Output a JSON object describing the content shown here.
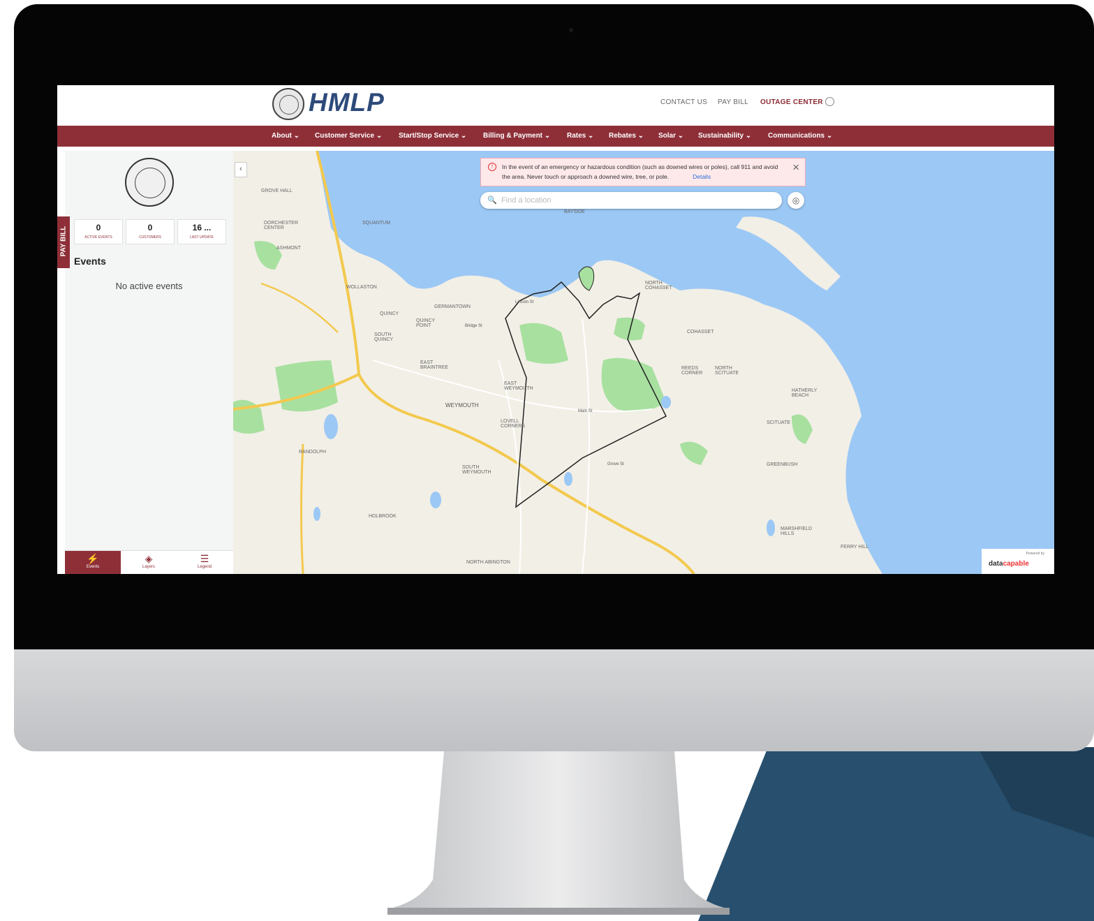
{
  "site": {
    "logo_text": "HMLP",
    "top_links": [
      "CONTACT US",
      "PAY BILL",
      "OUTAGE CENTER"
    ],
    "nav": [
      "About ⌄",
      "Customer Service ⌄",
      "Start/Stop Service ⌄",
      "Billing & Payment ⌄",
      "Rates ⌄",
      "Rebates ⌄",
      "Solar ⌄",
      "Sustainability ⌄",
      "Communications ⌄"
    ]
  },
  "panel": {
    "stats": [
      {
        "value": "0",
        "label": "ACTIVE EVENTS"
      },
      {
        "value": "0",
        "label": "CUSTOMERS"
      },
      {
        "value": "16 ...",
        "label": "LAST UPDATE"
      }
    ],
    "events_title": "Events",
    "no_events": "No active events",
    "pay_bill_tab": "PAY BILL",
    "tabs": [
      "Events",
      "Layers",
      "Legend"
    ]
  },
  "map": {
    "alert_text": "In the event of an emergency or hazardous condition (such as downed wires or poles), call 911 and avoid the area. Never touch or approach a downed wire, tree, or pole.",
    "alert_details": "Details",
    "search_placeholder": "Find a location",
    "places": [
      "GROVE HALL",
      "DORCHESTER CENTER",
      "ASHMONT",
      "SQUANTUM",
      "WOLLASTON",
      "QUINCY",
      "GERMANTOWN",
      "QUINCY POINT",
      "SOUTH QUINCY",
      "EAST BRAINTREE",
      "WEYMOUTH",
      "EAST WEYMOUTH",
      "LOVELL CORNERS",
      "RANDOLPH",
      "SOUTH WEYMOUTH",
      "HOLBROOK",
      "NORTH ABINGTON",
      "COHASSET",
      "NORTH COHASSET",
      "REEDS CORNER",
      "NORTH SCITUATE",
      "HATHERLY BEACH",
      "SCITUATE",
      "GREENBUSH",
      "MARSHFIELD HILLS",
      "FERRY HILL",
      "BAYSIDE",
      "Lincoln St",
      "Bridge St",
      "Main St",
      "Grove St"
    ],
    "powered_by": "Powered by",
    "brand_a": "data",
    "brand_b": "capable"
  },
  "colors": {
    "brand": "#8e2f38",
    "water": "#9cc8f5",
    "land": "#f2efe6",
    "park": "#a8e0a0"
  }
}
